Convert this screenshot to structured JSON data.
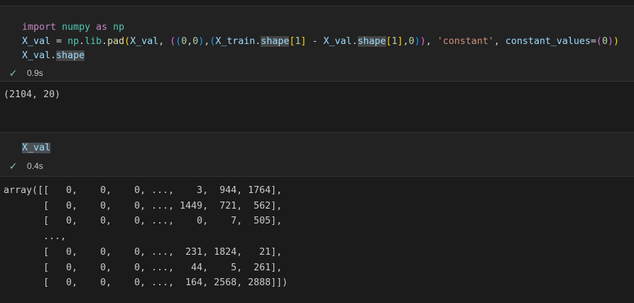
{
  "colors": {
    "background": "#1b1b1c",
    "cell_background": "#222223",
    "border": "#34353a",
    "keyword": "#C586C0",
    "module": "#4EC9B0",
    "variable": "#9CDCFE",
    "function": "#DCDCAA",
    "number": "#B5CEA8",
    "string": "#CE9178",
    "bracket_level1": "#FFD700",
    "bracket_level2": "#DA70D6",
    "bracket_level3": "#179FFF",
    "success_check": "#73C991",
    "output_text": "#cccccc"
  },
  "cell1": {
    "code_lines": [
      [
        {
          "t": "import",
          "c": "kw"
        },
        {
          "t": " ",
          "c": "op"
        },
        {
          "t": "numpy",
          "c": "mod"
        },
        {
          "t": " ",
          "c": "op"
        },
        {
          "t": "as",
          "c": "kw"
        },
        {
          "t": " ",
          "c": "op"
        },
        {
          "t": "np",
          "c": "mod"
        }
      ],
      [
        {
          "t": "X_val",
          "c": "var"
        },
        {
          "t": " = ",
          "c": "op"
        },
        {
          "t": "np",
          "c": "mod"
        },
        {
          "t": ".",
          "c": "op"
        },
        {
          "t": "lib",
          "c": "mod"
        },
        {
          "t": ".",
          "c": "op"
        },
        {
          "t": "pad",
          "c": "fn"
        },
        {
          "t": "(",
          "c": "b1"
        },
        {
          "t": "X_val",
          "c": "var"
        },
        {
          "t": ", ",
          "c": "op"
        },
        {
          "t": "(",
          "c": "b2"
        },
        {
          "t": "(",
          "c": "b3"
        },
        {
          "t": "0",
          "c": "num"
        },
        {
          "t": ",",
          "c": "op"
        },
        {
          "t": "0",
          "c": "num"
        },
        {
          "t": ")",
          "c": "b3"
        },
        {
          "t": ",",
          "c": "op"
        },
        {
          "t": "(",
          "c": "b3"
        },
        {
          "t": "X_train",
          "c": "var"
        },
        {
          "t": ".",
          "c": "op"
        },
        {
          "t": "shape",
          "c": "var hl"
        },
        {
          "t": "[",
          "c": "b1"
        },
        {
          "t": "1",
          "c": "num"
        },
        {
          "t": "]",
          "c": "b1"
        },
        {
          "t": " - ",
          "c": "op"
        },
        {
          "t": "X_val",
          "c": "var"
        },
        {
          "t": ".",
          "c": "op"
        },
        {
          "t": "shape",
          "c": "var hl"
        },
        {
          "t": "[",
          "c": "b1"
        },
        {
          "t": "1",
          "c": "num"
        },
        {
          "t": "]",
          "c": "b1"
        },
        {
          "t": ",",
          "c": "op"
        },
        {
          "t": "0",
          "c": "num"
        },
        {
          "t": ")",
          "c": "b3"
        },
        {
          "t": ")",
          "c": "b2"
        },
        {
          "t": ", ",
          "c": "op"
        },
        {
          "t": "'constant'",
          "c": "str"
        },
        {
          "t": ", ",
          "c": "op"
        },
        {
          "t": "constant_values",
          "c": "var"
        },
        {
          "t": "=",
          "c": "op"
        },
        {
          "t": "(",
          "c": "b2"
        },
        {
          "t": "0",
          "c": "num"
        },
        {
          "t": ")",
          "c": "b2"
        },
        {
          "t": ")",
          "c": "b1"
        }
      ],
      [
        {
          "t": "X_val",
          "c": "var"
        },
        {
          "t": ".",
          "c": "op"
        },
        {
          "t": "shape",
          "c": "var hl"
        }
      ]
    ],
    "status": {
      "icon": "success-check",
      "glyph": "✓",
      "time": "0.9s"
    }
  },
  "output1": {
    "text": "(2104, 20)"
  },
  "cell2": {
    "code_lines": [
      [
        {
          "t": "X_val",
          "c": "var sel"
        }
      ]
    ],
    "status": {
      "icon": "success-check",
      "glyph": "✓",
      "time": "0.4s"
    }
  },
  "output2": {
    "lines": [
      "array([[   0,    0,    0, ...,    3,  944, 1764],",
      "       [   0,    0,    0, ..., 1449,  721,  562],",
      "       [   0,    0,    0, ...,    0,    7,  505],",
      "       ...,",
      "       [   0,    0,    0, ...,  231, 1824,   21],",
      "       [   0,    0,    0, ...,   44,    5,  261],",
      "       [   0,    0,    0, ...,  164, 2568, 2888]])"
    ]
  }
}
